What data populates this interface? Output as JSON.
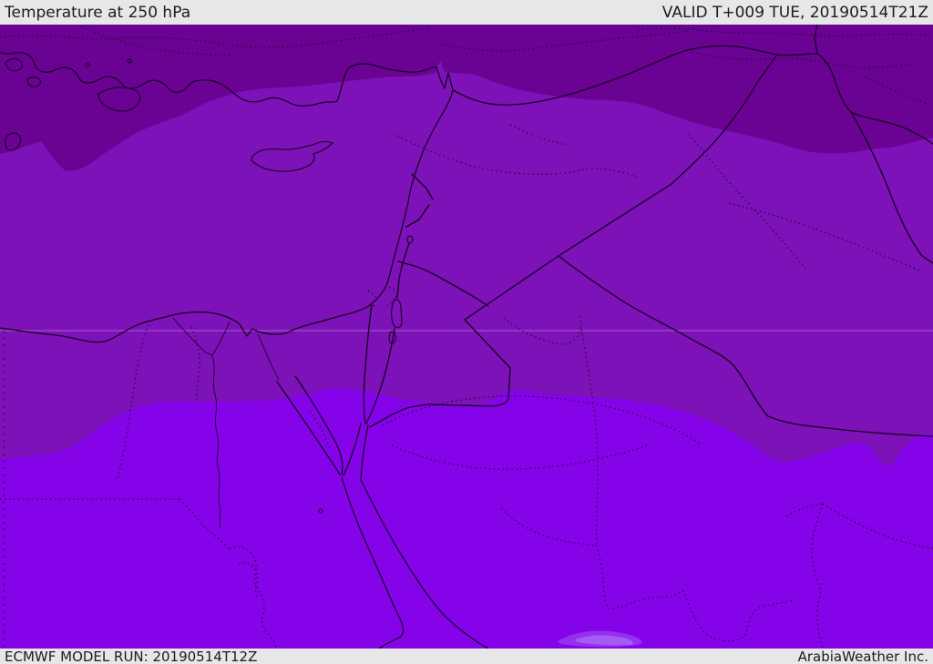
{
  "header": {
    "title": "Temperature at 250 hPa",
    "valid_time": "VALID T+009 TUE, 20190514T21Z"
  },
  "footer": {
    "model_run": "ECMWF MODEL RUN: 20190514T12Z",
    "credit": "ArabiaWeather Inc."
  },
  "map": {
    "region": "Middle East / Eastern Mediterranean",
    "colors": {
      "band_cold_dark": "#6A0394",
      "band_mid": "#7C12B7",
      "band_warm_bright": "#8403E8",
      "band_wisp": "#9530EE",
      "band_wisp_core": "#A65AF6",
      "border_line": "#16001f",
      "graticule": "#D9B8E8",
      "bar_background": "#E7E7E7",
      "bar_text": "#1C1C1C"
    }
  }
}
